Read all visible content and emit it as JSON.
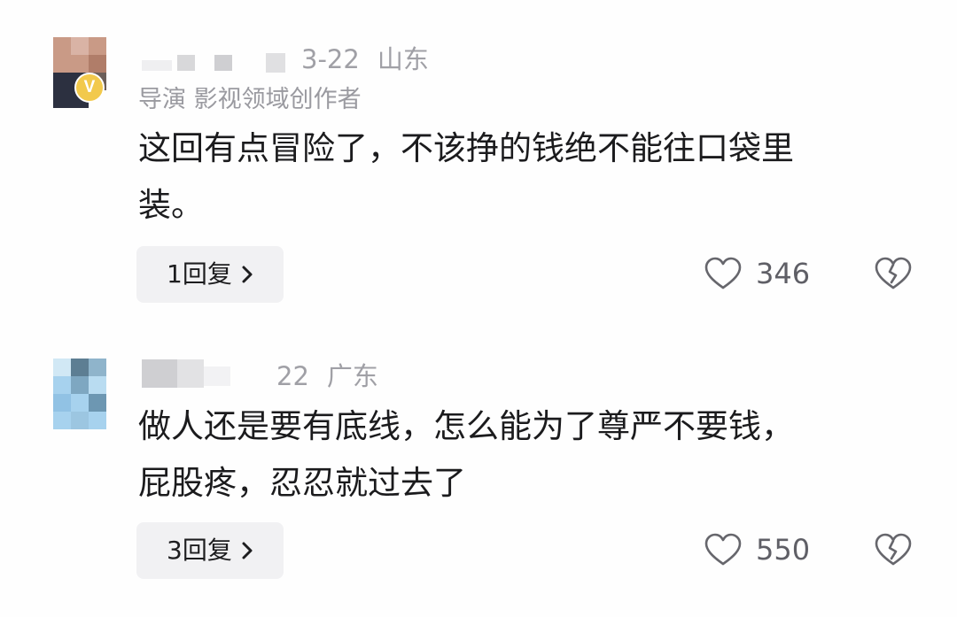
{
  "comments": [
    {
      "date": "3-22",
      "location": "山东",
      "role": "导演 影视领域创作者",
      "badge": "V",
      "text_lines": [
        "这回有点冒险了，不该挣的钱绝不能往口袋里",
        "装。"
      ],
      "replies_label": "1回复",
      "likes": "346",
      "icons": {
        "like": "heart-outline-icon",
        "dislike": "broken-heart-icon",
        "more": "chevron-right-icon"
      }
    },
    {
      "date": "22",
      "location": "广东",
      "text_lines": [
        "做人还是要有底线，怎么能为了尊严不要钱，",
        "屁股疼，忍忍就过去了"
      ],
      "replies_label": "3回复",
      "likes": "550",
      "icons": {
        "like": "heart-outline-icon",
        "dislike": "broken-heart-icon",
        "more": "chevron-right-icon"
      }
    }
  ],
  "colors": {
    "meta_text": "#a0a0a6",
    "badge": "#f2c94c",
    "reply_bg": "#f1f1f3"
  }
}
